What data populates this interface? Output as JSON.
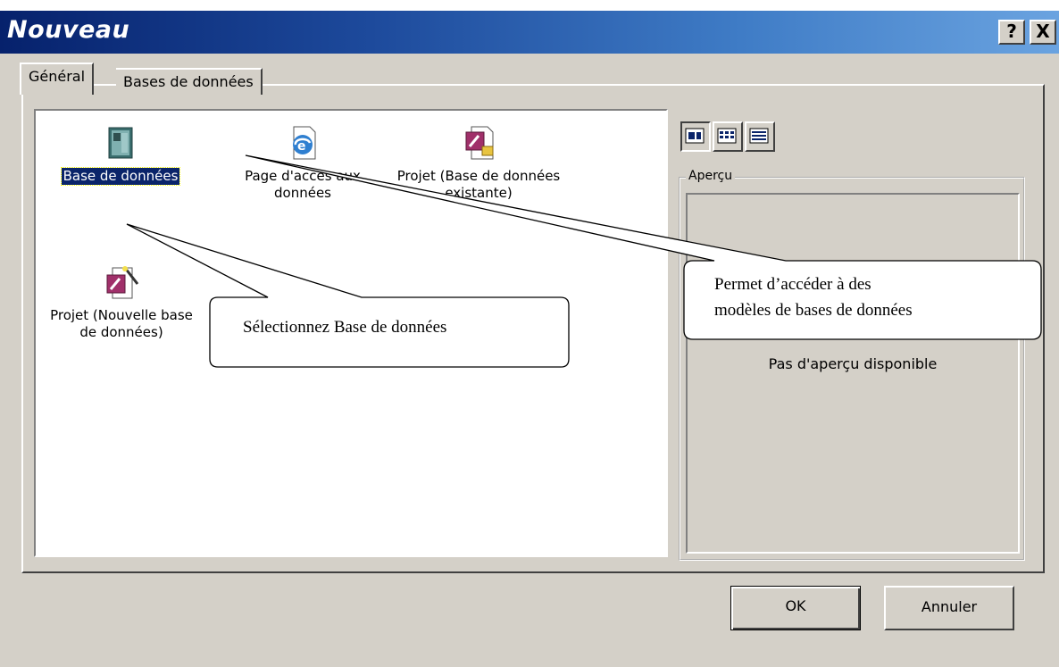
{
  "window": {
    "title": "Nouveau",
    "help_button": "?",
    "close_button": "X"
  },
  "tabs": [
    {
      "label": "Général",
      "active": true
    },
    {
      "label": "Bases de données",
      "active": false
    }
  ],
  "list_items": [
    {
      "label": "Base de données",
      "icon": "database-icon",
      "selected": true
    },
    {
      "label": "Page d'accès aux données",
      "icon": "data-access-page-icon",
      "selected": false
    },
    {
      "label": "Projet (Base de données existante)",
      "icon": "project-existing-icon",
      "selected": false
    },
    {
      "label": "Projet (Nouvelle base de données)",
      "icon": "project-new-icon",
      "selected": false
    }
  ],
  "view_buttons": [
    {
      "name": "large-icons",
      "icon": "large-icons-icon"
    },
    {
      "name": "small-icons",
      "icon": "small-icons-icon"
    },
    {
      "name": "list",
      "icon": "details-icon"
    }
  ],
  "preview": {
    "legend": "Aperçu",
    "empty_text": "Pas d'aperçu disponible"
  },
  "buttons": {
    "ok": "OK",
    "cancel": "Annuler"
  },
  "callouts": {
    "select": "Sélectionnez Base  de données",
    "models_line1": "Permet d’accéder à des",
    "models_line2": "modèles de bases de données"
  }
}
